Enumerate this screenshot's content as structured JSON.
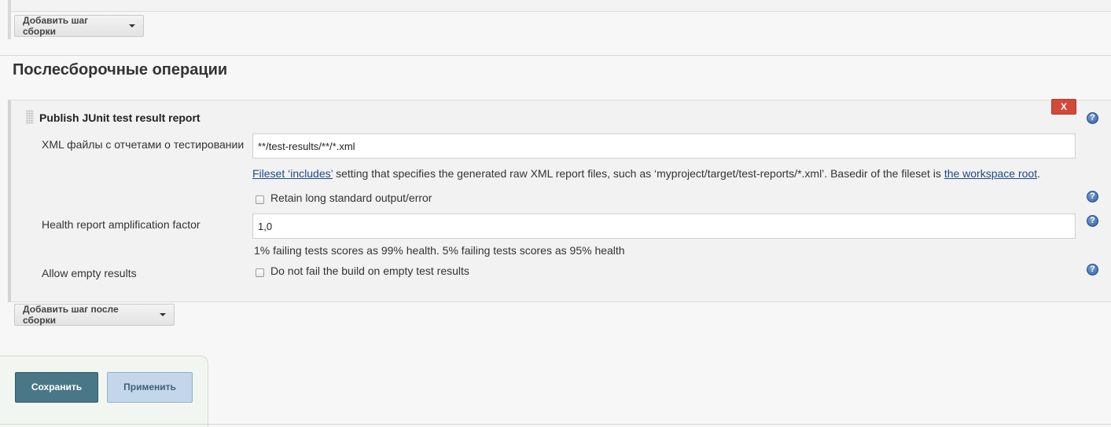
{
  "build_steps": {
    "add_step_button": "Добавить шаг сборки"
  },
  "post_build": {
    "title": "Послесборочные операции",
    "add_step_button": "Добавить шаг после сборки",
    "junit": {
      "title": "Publish JUnit test result report",
      "delete_label": "X",
      "xml_files": {
        "label": "XML файлы с отчетами о тестировании",
        "value": "**/test-results/**/*.xml",
        "desc_link1": "Fileset ‘includes’",
        "desc_text": " setting that specifies the generated raw XML report files, such as ‘myproject/target/test-reports/*.xml’. Basedir of the fileset is ",
        "desc_link2": "the workspace root",
        "desc_end": "."
      },
      "retain": {
        "label": "Retain long standard output/error",
        "checked": false
      },
      "health": {
        "label": "Health report amplification factor",
        "value": "1,0",
        "desc": "1% failing tests scores as 99% health. 5% failing tests scores as 95% health"
      },
      "allow_empty": {
        "label": "Allow empty results",
        "checkbox_label": "Do not fail the build on empty test results",
        "checked": false
      },
      "help_glyph": "?"
    }
  },
  "actions": {
    "save": "Сохранить",
    "apply": "Применить"
  },
  "colors": {
    "delete": "#d24939",
    "save": "#4a7788",
    "apply": "#c4d7ea",
    "help": "#2f5d9d",
    "link": "#204a87"
  }
}
